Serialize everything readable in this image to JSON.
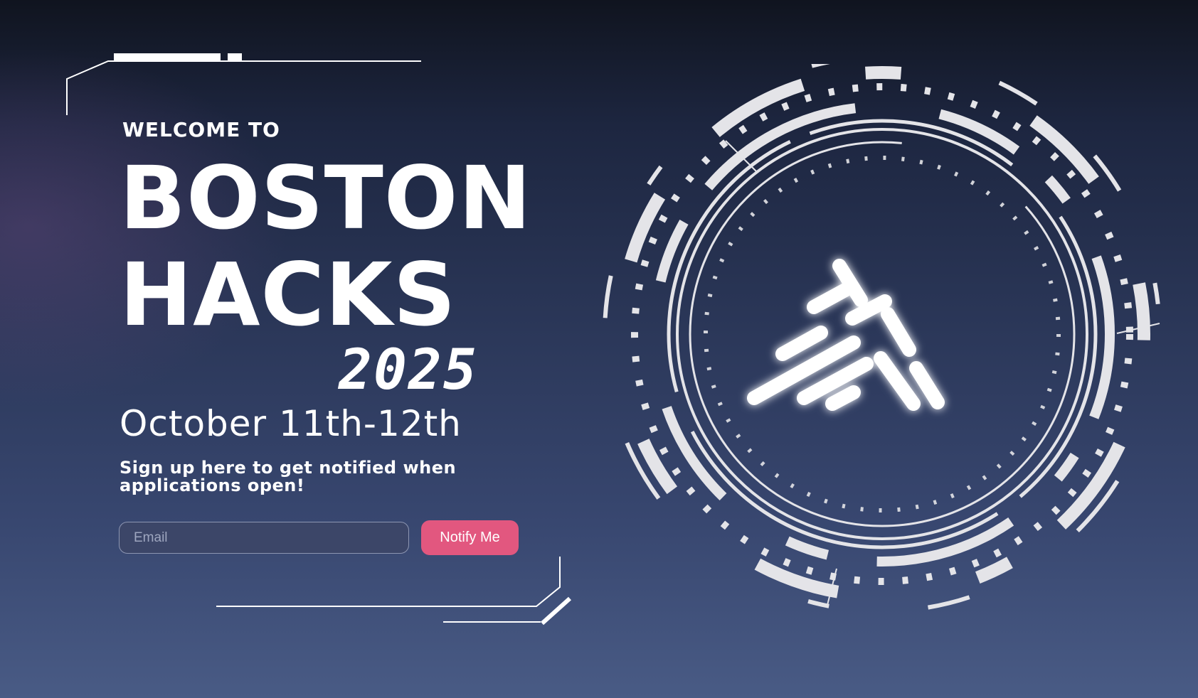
{
  "hero": {
    "welcome": "WELCOME TO",
    "title_line1": "BOSTON",
    "title_line2": "HACKS",
    "year": "2025",
    "dates": "October 11th-12th",
    "signup_text": "Sign up here to get notified when applications open!"
  },
  "signup_form": {
    "email_placeholder": "Email",
    "email_value": "",
    "notify_label": "Notify Me"
  },
  "colors": {
    "accent": "#e2577f",
    "text": "#ffffff",
    "bg_top": "#10141f",
    "bg_bottom": "#495b85"
  },
  "icons": [
    "hud-ring-emblem",
    "logo-stripes-icon",
    "frame-corner-decoration"
  ]
}
